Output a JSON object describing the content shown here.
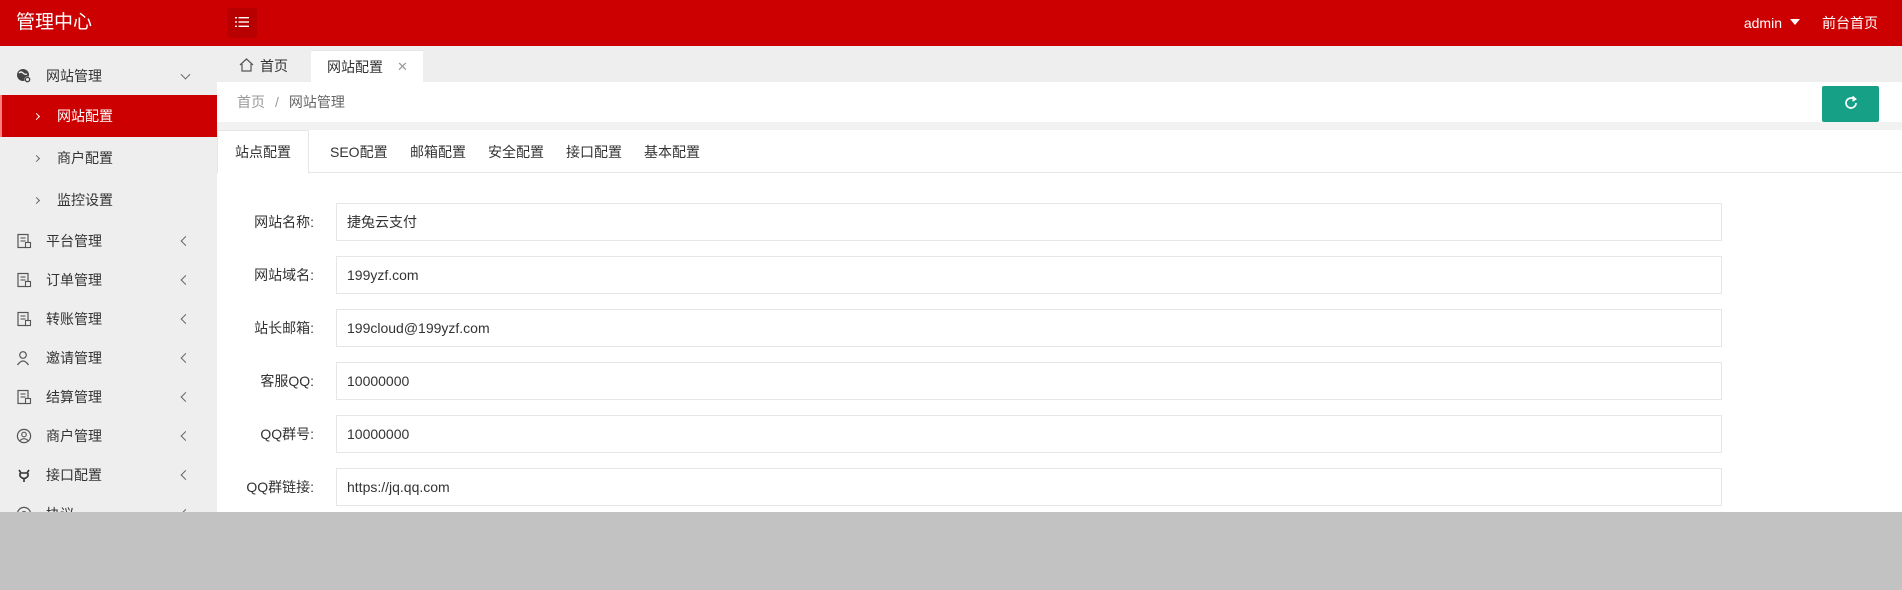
{
  "header": {
    "logo": "管理中心",
    "user": "admin",
    "front_link": "前台首页",
    "color": "#cc0000"
  },
  "sidebar": {
    "groups": [
      {
        "label": "网站管理",
        "icon": "globe-gear-icon",
        "expanded": true,
        "children": [
          {
            "label": "网站配置",
            "active": true
          },
          {
            "label": "商户配置",
            "active": false
          },
          {
            "label": "监控设置",
            "active": false
          }
        ]
      },
      {
        "label": "平台管理",
        "icon": "document-icon"
      },
      {
        "label": "订单管理",
        "icon": "document-icon"
      },
      {
        "label": "转账管理",
        "icon": "document-icon"
      },
      {
        "label": "邀请管理",
        "icon": "user-icon"
      },
      {
        "label": "结算管理",
        "icon": "document-icon"
      },
      {
        "label": "商户管理",
        "icon": "user-circle-icon"
      },
      {
        "label": "接口配置",
        "icon": "plug-icon"
      },
      {
        "label": "协议……",
        "icon": "circle-icon"
      }
    ]
  },
  "tabs": {
    "home": "首页",
    "active": "网站配置",
    "close": "✕"
  },
  "breadcrumb": {
    "home": "首页",
    "separator": "/",
    "current": "网站管理"
  },
  "config_tabs": [
    "站点配置",
    "SEO配置",
    "邮箱配置",
    "安全配置",
    "接口配置",
    "基本配置"
  ],
  "form": {
    "fields": [
      {
        "label": "网站名称:",
        "value": "捷兔云支付"
      },
      {
        "label": "网站域名:",
        "value": "199yzf.com"
      },
      {
        "label": "站长邮箱:",
        "value": "199cloud@199yzf.com"
      },
      {
        "label": "客服QQ:",
        "value": "10000000"
      },
      {
        "label": "QQ群号:",
        "value": "10000000"
      },
      {
        "label": "QQ群链接:",
        "value": "https://jq.qq.com"
      }
    ]
  },
  "colors": {
    "brand": "#cc0000",
    "refresh": "#16a085"
  }
}
